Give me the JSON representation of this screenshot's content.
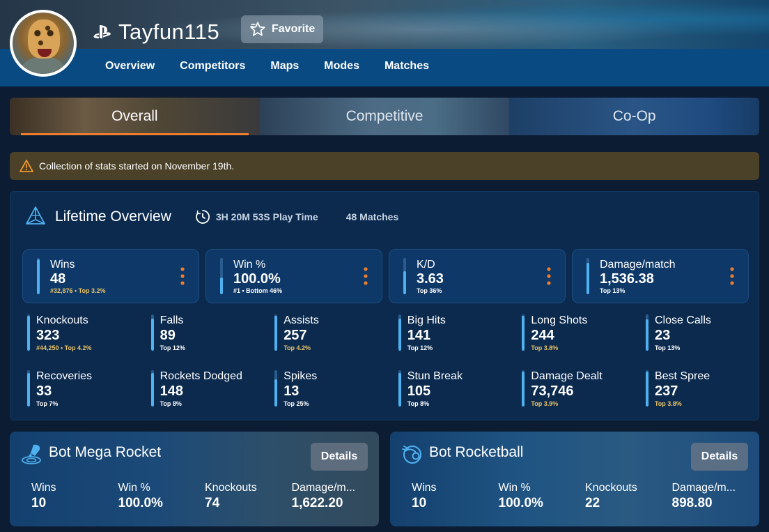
{
  "profile": {
    "platform_icon": "playstation-icon",
    "username": "Tayfun115",
    "favorite_label": "Favorite"
  },
  "nav": [
    "Overview",
    "Competitors",
    "Maps",
    "Modes",
    "Matches"
  ],
  "mode_tabs": [
    {
      "label": "Overall",
      "active": true
    },
    {
      "label": "Competitive",
      "active": false
    },
    {
      "label": "Co-Op",
      "active": false
    }
  ],
  "notice": {
    "icon": "warning-icon",
    "text": "Collection of stats started on November 19th."
  },
  "lifetime": {
    "title": "Lifetime Overview",
    "playtime": "3H 20M 53S Play Time",
    "matches": "48 Matches",
    "big": [
      {
        "label": "Wins",
        "value": "48",
        "rank": "#32,876 • Top 3.2%",
        "rank_gold": true,
        "fill": 0.97
      },
      {
        "label": "Win %",
        "value": "100.0%",
        "rank": "#1 • Bottom 46%",
        "rank_gold": false,
        "fill": 0.46
      },
      {
        "label": "K/D",
        "value": "3.63",
        "rank": "Top 36%",
        "rank_gold": false,
        "fill": 0.64
      },
      {
        "label": "Damage/match",
        "value": "1,536.38",
        "rank": "Top 13%",
        "rank_gold": false,
        "fill": 0.87
      }
    ],
    "stats": [
      {
        "label": "Knockouts",
        "value": "323",
        "rank": "#44,250 • Top 4.2%",
        "gold": true,
        "fill": 0.96
      },
      {
        "label": "Falls",
        "value": "89",
        "rank": "Top 12%",
        "gold": false,
        "fill": 0.88
      },
      {
        "label": "Assists",
        "value": "257",
        "rank": "Top 4.2%",
        "gold": true,
        "fill": 0.96
      },
      {
        "label": "Big Hits",
        "value": "141",
        "rank": "Top 12%",
        "gold": false,
        "fill": 0.88
      },
      {
        "label": "Long Shots",
        "value": "244",
        "rank": "Top 3.8%",
        "gold": true,
        "fill": 0.96
      },
      {
        "label": "Close Calls",
        "value": "23",
        "rank": "Top 13%",
        "gold": false,
        "fill": 0.87
      },
      {
        "label": "Recoveries",
        "value": "33",
        "rank": "Top 7%",
        "gold": false,
        "fill": 0.93
      },
      {
        "label": "Rockets Dodged",
        "value": "148",
        "rank": "Top 8%",
        "gold": false,
        "fill": 0.92
      },
      {
        "label": "Spikes",
        "value": "13",
        "rank": "Top 25%",
        "gold": false,
        "fill": 0.75
      },
      {
        "label": "Stun Break",
        "value": "105",
        "rank": "Top 8%",
        "gold": false,
        "fill": 0.92
      },
      {
        "label": "Damage Dealt",
        "value": "73,746",
        "rank": "Top 3.9%",
        "gold": true,
        "fill": 0.96
      },
      {
        "label": "Best Spree",
        "value": "237",
        "rank": "Top 3.8%",
        "gold": true,
        "fill": 0.96
      }
    ]
  },
  "playlists": [
    {
      "icon": "mega-rocket-icon",
      "title": "Bot Mega Rocket",
      "details_label": "Details",
      "stats": [
        {
          "label": "Wins",
          "value": "10"
        },
        {
          "label": "Win %",
          "value": "100.0%"
        },
        {
          "label": "Knockouts",
          "value": "74"
        },
        {
          "label": "Damage/m...",
          "value": "1,622.20"
        }
      ]
    },
    {
      "icon": "rocketball-icon",
      "title": "Bot Rocketball",
      "details_label": "Details",
      "stats": [
        {
          "label": "Wins",
          "value": "10"
        },
        {
          "label": "Win %",
          "value": "100.0%"
        },
        {
          "label": "Knockouts",
          "value": "22"
        },
        {
          "label": "Damage/m...",
          "value": "898.80"
        }
      ]
    }
  ],
  "colors": {
    "accent_orange": "#ee7d2d",
    "bar_blue": "#4fb1f0",
    "gold_text": "#e9c266",
    "nav_blue": "#0a4a83",
    "panel_bg": "#0b2a4e"
  }
}
